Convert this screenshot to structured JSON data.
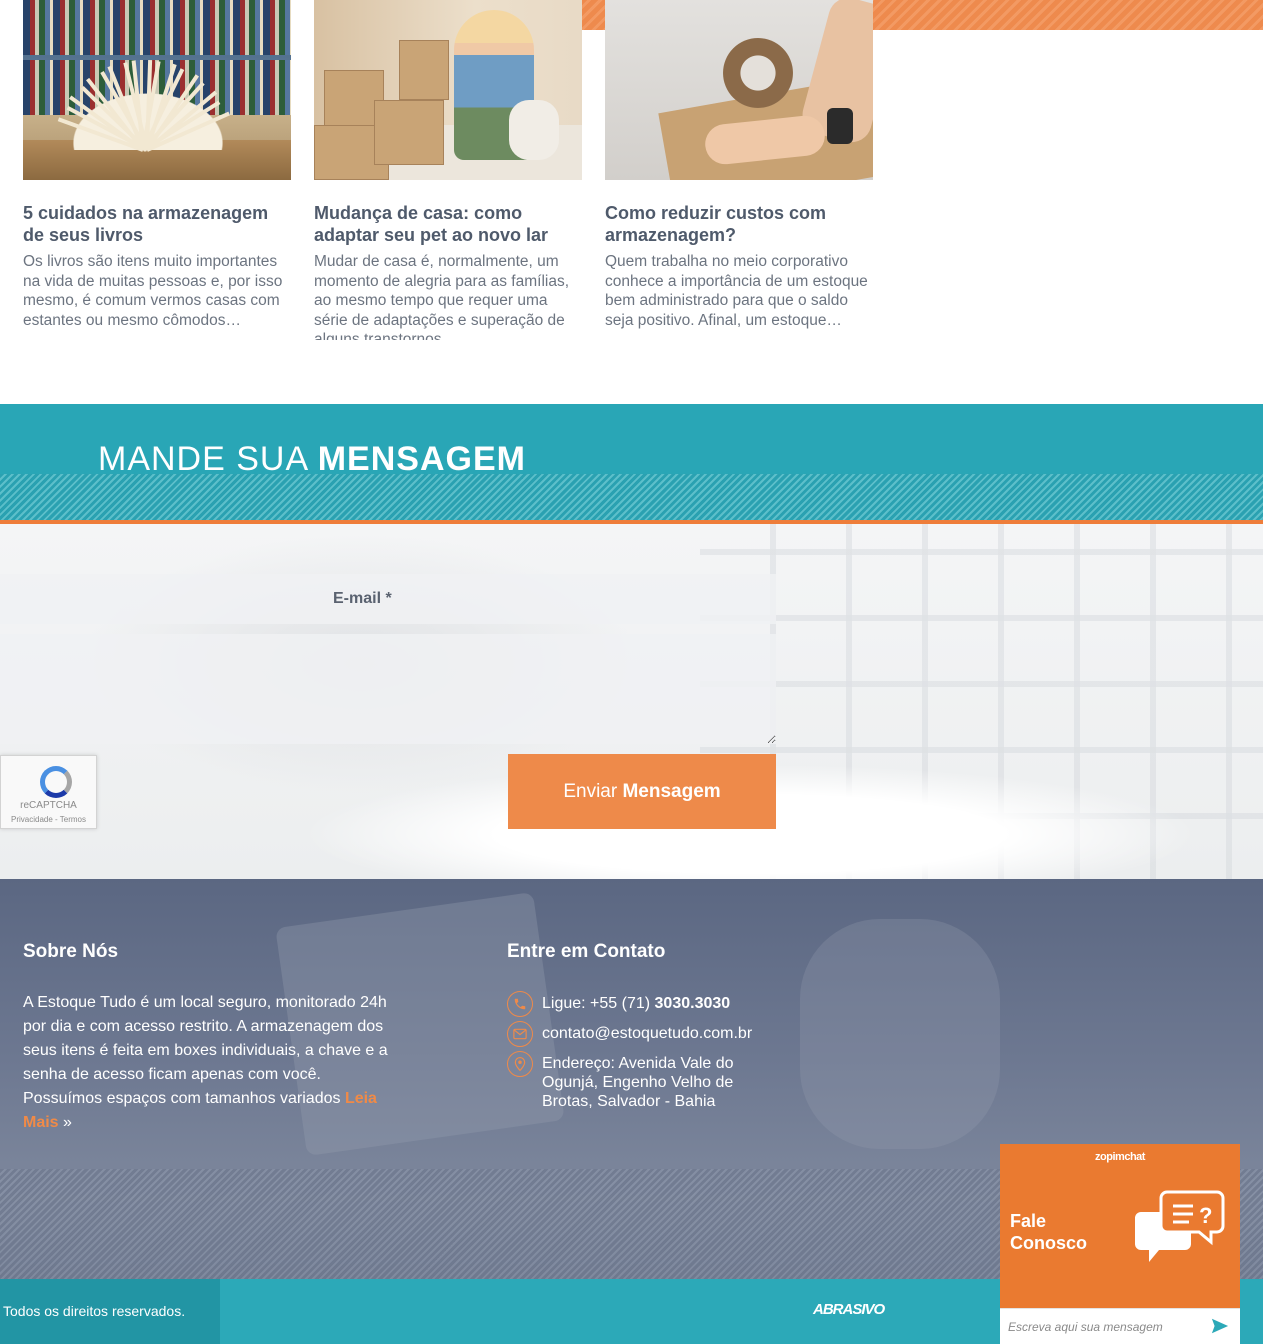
{
  "blog": {
    "posts": [
      {
        "title": "5 cuidados na armazenagem de seus livros",
        "excerpt": "Os livros são itens muito importantes na vida de muitas pessoas e, por isso mesmo, é comum vermos casas com estantes ou mesmo cômodos…"
      },
      {
        "title": "Mudança de casa: como adaptar seu pet ao novo lar",
        "excerpt": "Mudar de casa é, normalmente, um momento de alegria para as famílias, ao mesmo tempo que requer uma série de adaptações e superação de alguns transtornos…"
      },
      {
        "title": "Como reduzir custos com armazenagem?",
        "excerpt": "Quem trabalha no meio corporativo conhece a importância de um estoque bem administrado para que o saldo seja positivo. Afinal, um estoque…"
      }
    ]
  },
  "message": {
    "title_light": "MANDE SUA",
    "title_bold": "MENSAGEM",
    "email_placeholder": "E-mail *",
    "message_placeholder": "",
    "send_light": "Enviar",
    "send_bold": "Mensagem",
    "recaptcha_label": "reCAPTCHA",
    "recaptcha_links": "Privacidade - Termos"
  },
  "footer": {
    "about": {
      "title_light": "Sobre",
      "title_bold": "Nós",
      "text": "A Estoque Tudo é um local seguro, monitorado 24h por dia e com acesso restrito. A armazenagem dos seus itens é feita em boxes individuais, a chave e a senha de acesso ficam apenas com você. Possuímos espaços com tamanhos variados",
      "more_label": "Leia Mais",
      "more_suffix": " »"
    },
    "contact": {
      "title_light": "Entre em",
      "title_bold": "Contato",
      "phone_prefix": "Ligue: +55 (71)",
      "phone_number": "3030.3030",
      "email": "contato@estoquetudo.com.br",
      "address": "Endereço: Avenida Vale do Ogunjá, Engenho Velho de Brotas, Salvador - Bahia"
    }
  },
  "bottom": {
    "copyright": "Todos os direitos reservados.",
    "agency": "ABRASIVO"
  },
  "chat": {
    "brand": "zopimchat",
    "title": "Fale Conosco",
    "input_placeholder": "Escreva aqui sua mensagem"
  },
  "colors": {
    "accent_orange": "#ee8a4a",
    "teal": "#29a6b6",
    "footer_slate": "#5b6782"
  }
}
